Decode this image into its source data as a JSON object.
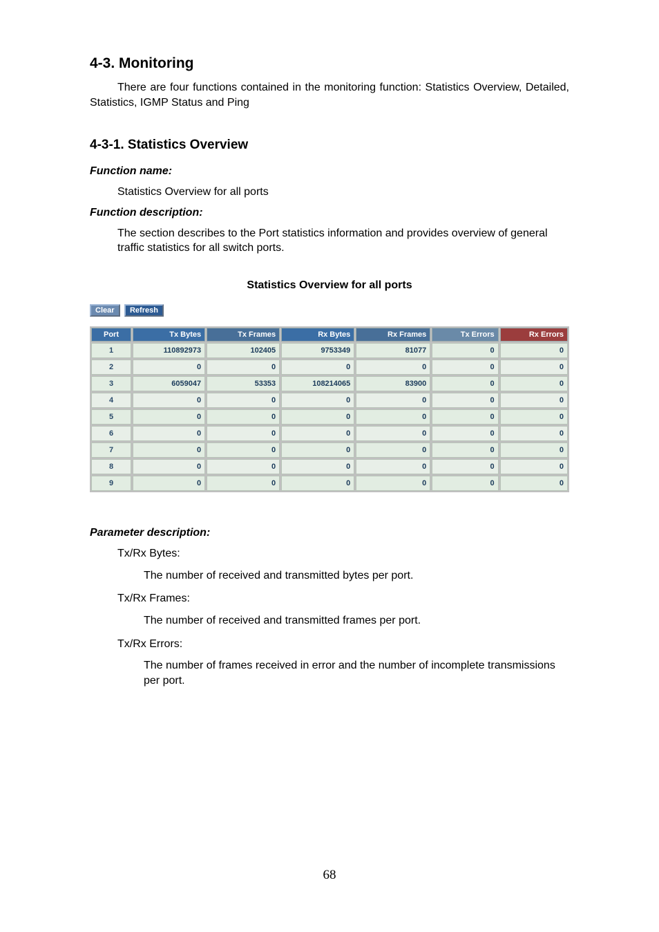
{
  "heading_43": "4-3. Monitoring",
  "intro_text": "There are four functions contained in the monitoring function: Statistics Overview, Detailed, Statistics, IGMP Status and Ping",
  "heading_431": "4-3-1. Statistics Overview",
  "labels": {
    "function_name": "Function name:",
    "function_description": "Function description:",
    "parameter_description": "Parameter description:"
  },
  "func_name_text": "Statistics Overview for all ports",
  "func_desc_text": "The section describes to the Port statistics information and provides overview of general traffic statistics for all switch ports.",
  "screenshot": {
    "title": "Statistics Overview for all ports",
    "buttons": {
      "clear": "Clear",
      "refresh": "Refresh"
    },
    "headers": [
      "Port",
      "Tx Bytes",
      "Tx Frames",
      "Rx Bytes",
      "Rx Frames",
      "Tx Errors",
      "Rx Errors"
    ]
  },
  "chart_data": {
    "type": "table",
    "columns": [
      "Port",
      "Tx Bytes",
      "Tx Frames",
      "Rx Bytes",
      "Rx Frames",
      "Tx Errors",
      "Rx Errors"
    ],
    "rows": [
      {
        "port": "1",
        "tx_bytes": "110892973",
        "tx_frames": "102405",
        "rx_bytes": "9753349",
        "rx_frames": "81077",
        "tx_errors": "0",
        "rx_errors": "0"
      },
      {
        "port": "2",
        "tx_bytes": "0",
        "tx_frames": "0",
        "rx_bytes": "0",
        "rx_frames": "0",
        "tx_errors": "0",
        "rx_errors": "0"
      },
      {
        "port": "3",
        "tx_bytes": "6059047",
        "tx_frames": "53353",
        "rx_bytes": "108214065",
        "rx_frames": "83900",
        "tx_errors": "0",
        "rx_errors": "0"
      },
      {
        "port": "4",
        "tx_bytes": "0",
        "tx_frames": "0",
        "rx_bytes": "0",
        "rx_frames": "0",
        "tx_errors": "0",
        "rx_errors": "0"
      },
      {
        "port": "5",
        "tx_bytes": "0",
        "tx_frames": "0",
        "rx_bytes": "0",
        "rx_frames": "0",
        "tx_errors": "0",
        "rx_errors": "0"
      },
      {
        "port": "6",
        "tx_bytes": "0",
        "tx_frames": "0",
        "rx_bytes": "0",
        "rx_frames": "0",
        "tx_errors": "0",
        "rx_errors": "0"
      },
      {
        "port": "7",
        "tx_bytes": "0",
        "tx_frames": "0",
        "rx_bytes": "0",
        "rx_frames": "0",
        "tx_errors": "0",
        "rx_errors": "0"
      },
      {
        "port": "8",
        "tx_bytes": "0",
        "tx_frames": "0",
        "rx_bytes": "0",
        "rx_frames": "0",
        "tx_errors": "0",
        "rx_errors": "0"
      },
      {
        "port": "9",
        "tx_bytes": "0",
        "tx_frames": "0",
        "rx_bytes": "0",
        "rx_frames": "0",
        "tx_errors": "0",
        "rx_errors": "0"
      }
    ]
  },
  "params": [
    {
      "name": "Tx/Rx Bytes:",
      "desc": "The number of received and transmitted bytes per port."
    },
    {
      "name": "Tx/Rx Frames:",
      "desc": "The number of received and transmitted frames per port."
    },
    {
      "name": "Tx/Rx Errors:",
      "desc": "The number of frames received in error and the number of incomplete transmissions per port."
    }
  ],
  "page_number": "68"
}
